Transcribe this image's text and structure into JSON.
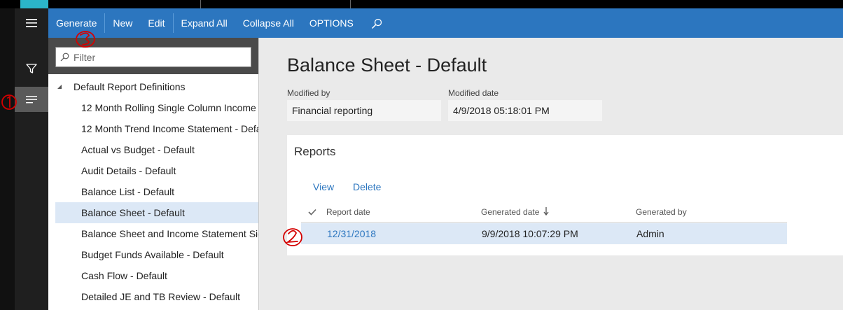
{
  "toolbar": {
    "generate": "Generate",
    "new": "New",
    "edit": "Edit",
    "expand_all": "Expand All",
    "collapse_all": "Collapse All",
    "options": "OPTIONS"
  },
  "filter": {
    "placeholder": "Filter"
  },
  "tree": {
    "root": "Default Report Definitions",
    "items": [
      "12 Month Rolling Single Column Income",
      "12 Month Trend Income Statement - Defa",
      "Actual vs Budget - Default",
      "Audit Details - Default",
      "Balance List - Default",
      "Balance Sheet - Default",
      "Balance Sheet and Income Statement Sid",
      "Budget Funds Available - Default",
      "Cash Flow - Default",
      "Detailed JE and TB Review - Default"
    ]
  },
  "detail": {
    "title": "Balance Sheet - Default",
    "modified_by_label": "Modified by",
    "modified_by": "Financial reporting",
    "modified_date_label": "Modified date",
    "modified_date": "4/9/2018 05:18:01 PM"
  },
  "reports": {
    "title": "Reports",
    "view": "View",
    "delete": "Delete",
    "columns": [
      "Report date",
      "Generated date",
      "Generated by"
    ],
    "rows": [
      {
        "report_date": "12/31/2018",
        "generated_date": "9/9/2018 10:07:29 PM",
        "generated_by": "Admin"
      }
    ]
  },
  "icons": {
    "menu": "hamburger-icon",
    "filter": "funnel-icon",
    "list": "list-icon",
    "search": "search-icon",
    "collapse": "triangle-icon",
    "sort": "arrow-down-icon",
    "check": "checkmark-icon"
  },
  "colors": {
    "toolbar": "#2c76bf",
    "selection": "#dce8f6",
    "link": "#2c76bf",
    "annotation": "#d40000"
  }
}
